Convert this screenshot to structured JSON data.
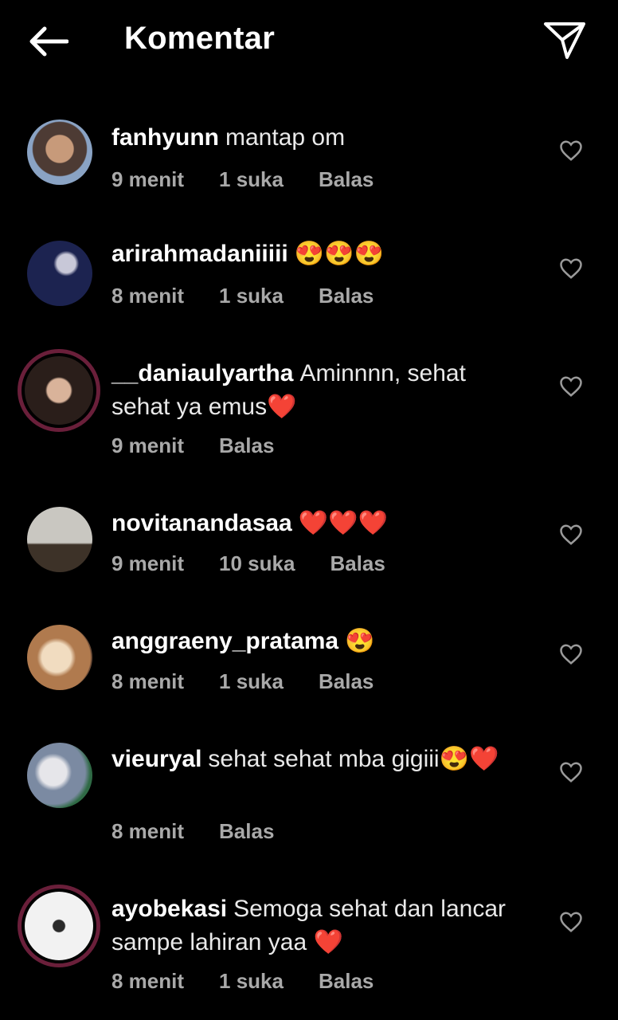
{
  "header": {
    "title": "Komentar"
  },
  "comments": [
    {
      "username": "fanhyunn",
      "text": "mantap om",
      "time": "9 menit",
      "likes": "1 suka",
      "reply": "Balas"
    },
    {
      "username": "arirahmadaniiiii",
      "text": "😍😍😍",
      "time": "8 menit",
      "likes": "1 suka",
      "reply": "Balas"
    },
    {
      "username": "__daniaulyartha",
      "text": "Aminnnn, sehat sehat ya emus❤️",
      "time": "9 menit",
      "reply": "Balas"
    },
    {
      "username": "novitanandasaa",
      "text": "❤️❤️❤️",
      "time": "9 menit",
      "likes": "10 suka",
      "reply": "Balas"
    },
    {
      "username": "anggraeny_pratama",
      "text": "😍",
      "time": "8 menit",
      "likes": "1 suka",
      "reply": "Balas"
    },
    {
      "username": "vieuryal",
      "text": "sehat sehat mba gigiii😍❤️",
      "time": "8 menit",
      "reply": "Balas"
    },
    {
      "username": "ayobekasi",
      "text": "Semoga sehat dan lancar sampe lahiran yaa ❤️",
      "time": "8 menit",
      "likes": "1 suka",
      "reply": "Balas"
    }
  ],
  "colors": {
    "background": "#000000",
    "story_ring": "#6a1f3a",
    "meta_text": "#a9a9a9"
  },
  "icons": {
    "back": "arrow-left-icon",
    "send": "paper-plane-icon",
    "like": "heart-outline-icon"
  }
}
